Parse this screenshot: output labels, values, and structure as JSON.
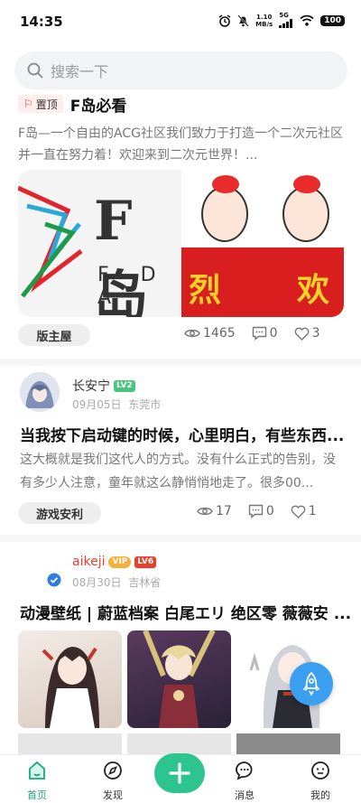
{
  "status_bar": {
    "time": "14:35",
    "net_speed_value": "1.10",
    "net_speed_unit": "MB/s",
    "signal_label": "5G",
    "battery": "100"
  },
  "search": {
    "placeholder": "搜索一下",
    "icon": "search-icon"
  },
  "posts": [
    {
      "badge": "置顶",
      "title": "F岛必看",
      "body": "F岛—一个自由的ACG社区我们致力于打造一个二次元社区并一直在努力着！欢迎来到二次元世界！",
      "body_suffix": "...",
      "logo_text": "F岛",
      "logo_sub": "F D A",
      "banner_chars": [
        "烈",
        "欢"
      ],
      "tag": "版主屋",
      "views": "1465",
      "comments": "0",
      "likes": "3"
    },
    {
      "author": "长安宁",
      "level": "LV2",
      "date": "09月05日",
      "location": "东莞市",
      "title": "当我按下启动键的时候，心里明白，有些东西...",
      "body": "这大概就是我们这代人的方式。没有什么正式的告别，没有多少人注意，童年就这么静悄悄地走了。很多00...",
      "tag": "游戏安利",
      "views": "17",
      "comments": "0",
      "likes": "1"
    },
    {
      "author": "aikeji",
      "vip": "VIP",
      "level": "LV6",
      "date": "08月30日",
      "location": "吉林省",
      "title": "动漫壁纸 | 蔚蓝档案 白尾エリ 绝区零 薇薇安 ..."
    }
  ],
  "tabbar": {
    "items": [
      {
        "label": "首页",
        "icon": "home-icon"
      },
      {
        "label": "发现",
        "icon": "compass-icon"
      },
      {
        "label": "",
        "icon": "plus-icon"
      },
      {
        "label": "消息",
        "icon": "message-icon"
      },
      {
        "label": "我的",
        "icon": "profile-icon"
      }
    ],
    "active_color": "#1aa77a",
    "add_color": "#2ec48f"
  },
  "colors": {
    "accent": "#2ec48f",
    "fab": "#3a9ff0",
    "lv2": "#4bc57d",
    "lv6": "#e6402f",
    "vip": "#f3b13a"
  }
}
